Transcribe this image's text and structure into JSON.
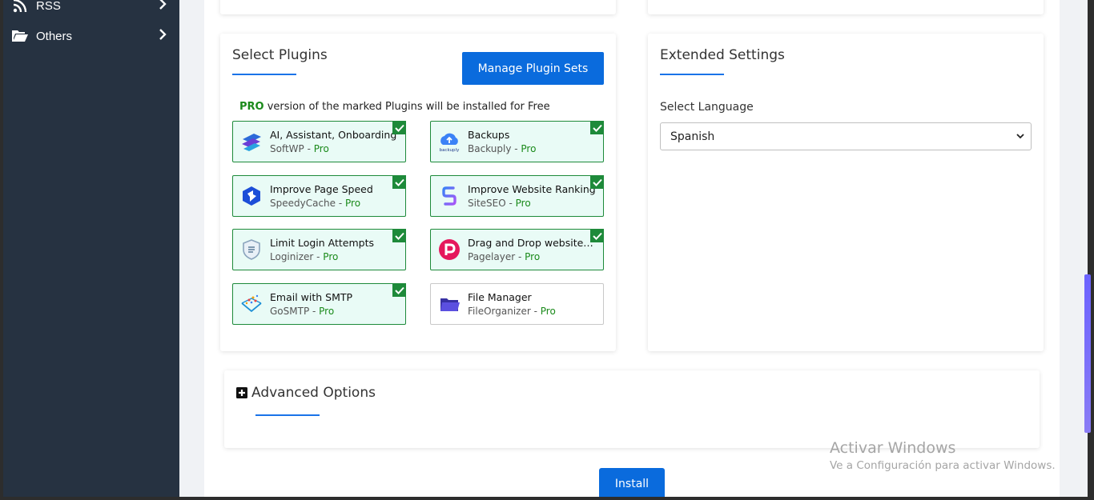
{
  "sidebar": {
    "items": [
      {
        "label": "RSS",
        "icon": "rss-icon"
      },
      {
        "label": "Others",
        "icon": "folder-open-icon"
      }
    ]
  },
  "select_plugins": {
    "title": "Select Plugins",
    "manage_button": "Manage Plugin Sets",
    "note_pro": "PRO",
    "note_text": " version of the marked Plugins will be installed for Free",
    "pro_label": "Pro",
    "plugins": [
      {
        "name": "AI, Assistant, Onboarding",
        "vendor": "SoftWP",
        "checked": true,
        "icon": "softwp-icon"
      },
      {
        "name": "Backups",
        "vendor": "Backuply",
        "checked": true,
        "icon": "backuply-cloud-icon"
      },
      {
        "name": "Improve Page Speed",
        "vendor": "SpeedyCache",
        "checked": true,
        "icon": "speedycache-icon"
      },
      {
        "name": "Improve Website Ranking",
        "vendor": "SiteSEO",
        "checked": true,
        "icon": "siteseo-icon"
      },
      {
        "name": "Limit Login Attempts",
        "vendor": "Loginizer",
        "checked": true,
        "icon": "loginizer-shield-icon"
      },
      {
        "name": "Drag and Drop website…",
        "vendor": "Pagelayer",
        "checked": true,
        "icon": "pagelayer-icon"
      },
      {
        "name": "Email with SMTP",
        "vendor": "GoSMTP",
        "checked": true,
        "icon": "gosmtp-icon"
      },
      {
        "name": "File Manager",
        "vendor": "FileOrganizer",
        "checked": false,
        "icon": "fileorganizer-folder-icon"
      }
    ]
  },
  "extended_settings": {
    "title": "Extended Settings",
    "language_label": "Select Language",
    "language_value": "Spanish"
  },
  "advanced_options": {
    "title": "Advanced Options"
  },
  "install_button": "Install",
  "watermark": {
    "line1": "Activar Windows",
    "line2": "Ve a Configuración para activar Windows."
  },
  "colors": {
    "primary": "#0a6bdd",
    "checked_border": "#1e8a3a",
    "checked_bg": "#e9fbf6",
    "sidebar_bg": "#263241",
    "pro_green": "#1a8a1a"
  }
}
